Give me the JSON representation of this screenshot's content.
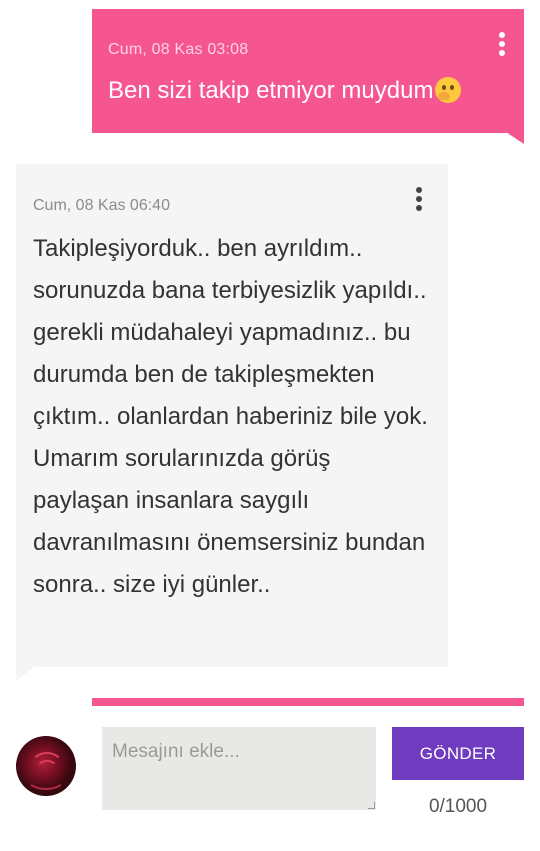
{
  "messages": [
    {
      "direction": "outgoing",
      "timestamp": "Cum, 08 Kas 03:08",
      "text": "Ben sizi takip etmiyor muydum",
      "emoji": "thinking-face-icon",
      "color": "#f55690"
    },
    {
      "direction": "incoming",
      "timestamp": "Cum, 08 Kas 06:40",
      "text": "Takipleşiyorduk.. ben ayrıldım.. sorunuzda bana terbiyesizlik yapıldı.. gerekli müdahaleyi yapmadınız.. bu durumda ben de takipleşmekten çıktım.. olanlardan haberiniz bile yok. Umarım sorularınızda görüş paylaşan insanlara saygılı davranılmasını önemsersiniz bundan sonra.. size iyi günler..",
      "color": "#f5f5f5"
    }
  ],
  "composer": {
    "placeholder": "Mesajını ekle...",
    "value": "",
    "send_label": "GÖNDER",
    "counter": "0/1000",
    "send_color": "#6f3bbf"
  },
  "icons": {
    "menu": "more-vertical-icon",
    "avatar": "rose-avatar"
  }
}
